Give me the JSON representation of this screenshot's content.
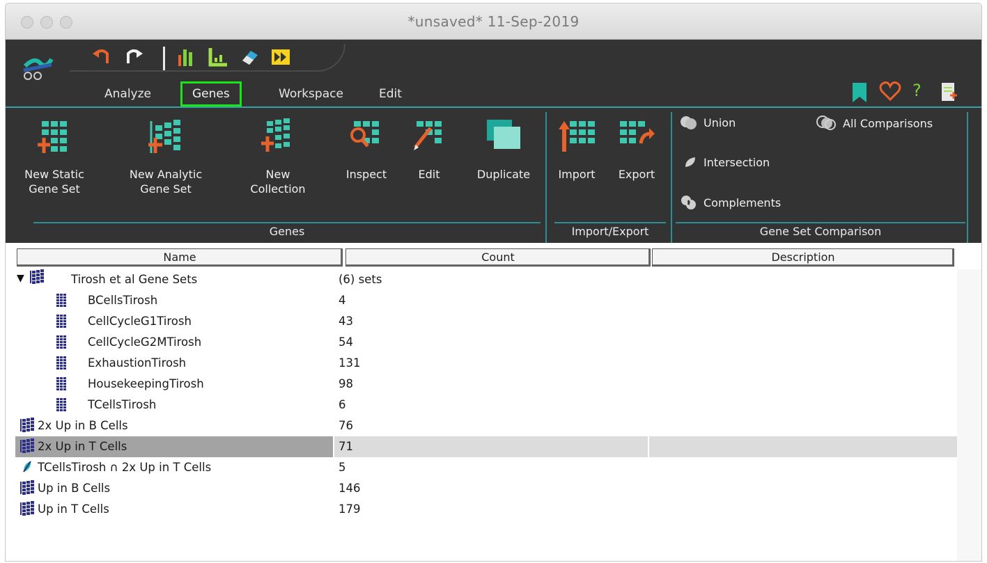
{
  "window": {
    "title": "*unsaved* 11-Sep-2019"
  },
  "colors": {
    "ribbon_bg": "#333333",
    "accent_teal": "#3a9fa7",
    "active_tab_border": "#19e619",
    "selected_row": "#a3a3a3"
  },
  "toolbar": {
    "quick_icons": [
      "undo-icon",
      "redo-icon",
      "bar-chart-icon",
      "axes-icon",
      "eraser-icon",
      "forward-icon"
    ]
  },
  "menu": {
    "tabs": [
      {
        "label": "Analyze"
      },
      {
        "label": "Genes",
        "active": true
      },
      {
        "label": "Workspace"
      },
      {
        "label": "Edit"
      }
    ],
    "right_icons": [
      "bookmark-icon",
      "heart-icon",
      "help-icon",
      "new-document-icon"
    ],
    "help_label": "?"
  },
  "ribbon": {
    "genes_group": {
      "label": "Genes",
      "buttons": [
        {
          "line1": "New Static",
          "line2": "Gene Set"
        },
        {
          "line1": "New Analytic",
          "line2": "Gene Set"
        },
        {
          "line1": "New",
          "line2": "Collection"
        },
        {
          "line1": "Inspect",
          "line2": ""
        },
        {
          "line1": "Edit",
          "line2": ""
        },
        {
          "line1": "Duplicate",
          "line2": ""
        }
      ]
    },
    "import_group": {
      "label": "Import/Export",
      "buttons": [
        {
          "line1": "Import"
        },
        {
          "line1": "Export"
        }
      ]
    },
    "comparison_group": {
      "label": "Gene Set Comparison",
      "items": [
        "Union",
        "All Comparisons",
        "Intersection",
        "Complements"
      ]
    }
  },
  "table": {
    "columns": [
      "Name",
      "Count",
      "Description"
    ],
    "rows": [
      {
        "name": "Tirosh et al Gene Sets",
        "count": "(6) sets",
        "level": 0,
        "icon": "collection-icon",
        "expanded": true
      },
      {
        "name": "BCellsTirosh",
        "count": "4",
        "level": 1,
        "icon": "static-gene-set-icon"
      },
      {
        "name": "CellCycleG1Tirosh",
        "count": "43",
        "level": 1,
        "icon": "static-gene-set-icon"
      },
      {
        "name": "CellCycleG2MTirosh",
        "count": "54",
        "level": 1,
        "icon": "static-gene-set-icon"
      },
      {
        "name": "ExhaustionTirosh",
        "count": "131",
        "level": 1,
        "icon": "static-gene-set-icon"
      },
      {
        "name": "HousekeepingTirosh",
        "count": "98",
        "level": 1,
        "icon": "static-gene-set-icon"
      },
      {
        "name": "TCellsTirosh",
        "count": "6",
        "level": 1,
        "icon": "static-gene-set-icon"
      },
      {
        "name": "2x Up in B Cells",
        "count": "76",
        "level": 0,
        "icon": "analytic-gene-set-icon"
      },
      {
        "name": "2x Up in T Cells",
        "count": "71",
        "level": 0,
        "icon": "analytic-gene-set-icon",
        "selected": true
      },
      {
        "name": "TCellsTirosh ∩ 2x Up in T Cells",
        "count": "5",
        "level": 0,
        "icon": "intersection-gene-set-icon"
      },
      {
        "name": "Up in B Cells",
        "count": "146",
        "level": 0,
        "icon": "analytic-gene-set-icon"
      },
      {
        "name": "Up in T Cells",
        "count": "179",
        "level": 0,
        "icon": "analytic-gene-set-icon"
      }
    ]
  }
}
